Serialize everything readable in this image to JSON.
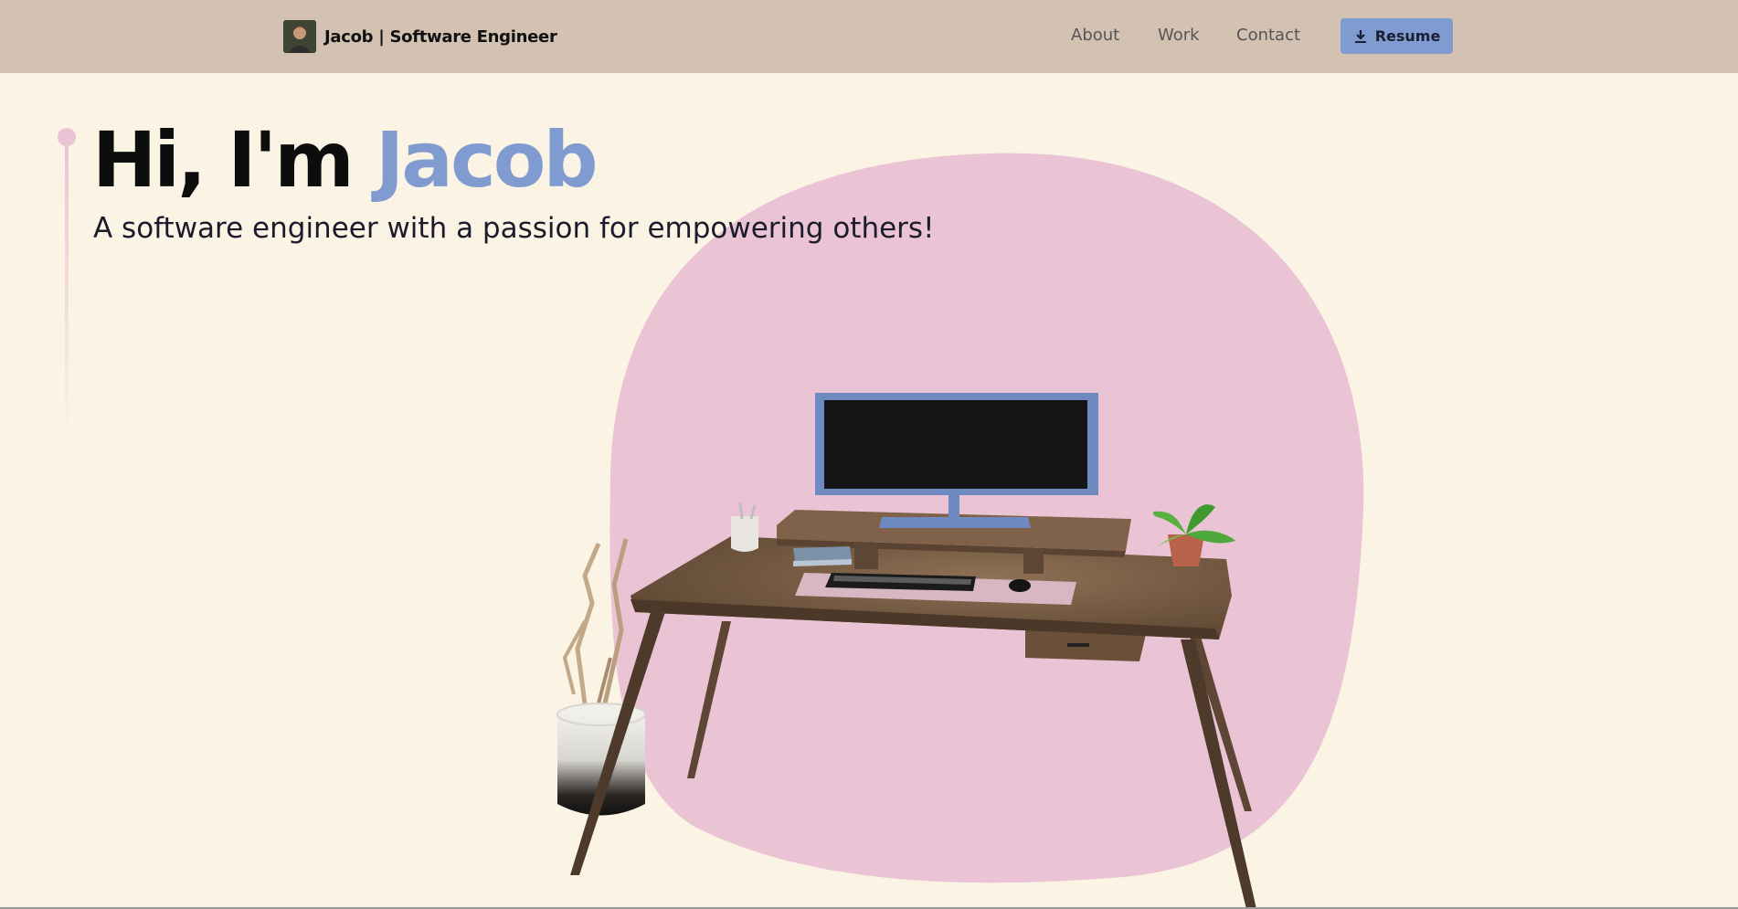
{
  "nav": {
    "brand": "Jacob | Software Engineer",
    "links": [
      "About",
      "Work",
      "Contact"
    ],
    "resume_label": "Resume"
  },
  "hero": {
    "greeting": "Hi, I'm ",
    "name": "Jacob",
    "subtitle": "A software engineer with a passion for empowering others!"
  },
  "colors": {
    "navbar_bg": "#D3C1B1",
    "page_bg": "#FBF4E4",
    "accent_blue": "#7F9BD0",
    "accent_pink": "#EAC4D5"
  },
  "icons": {
    "resume": "download-icon"
  }
}
